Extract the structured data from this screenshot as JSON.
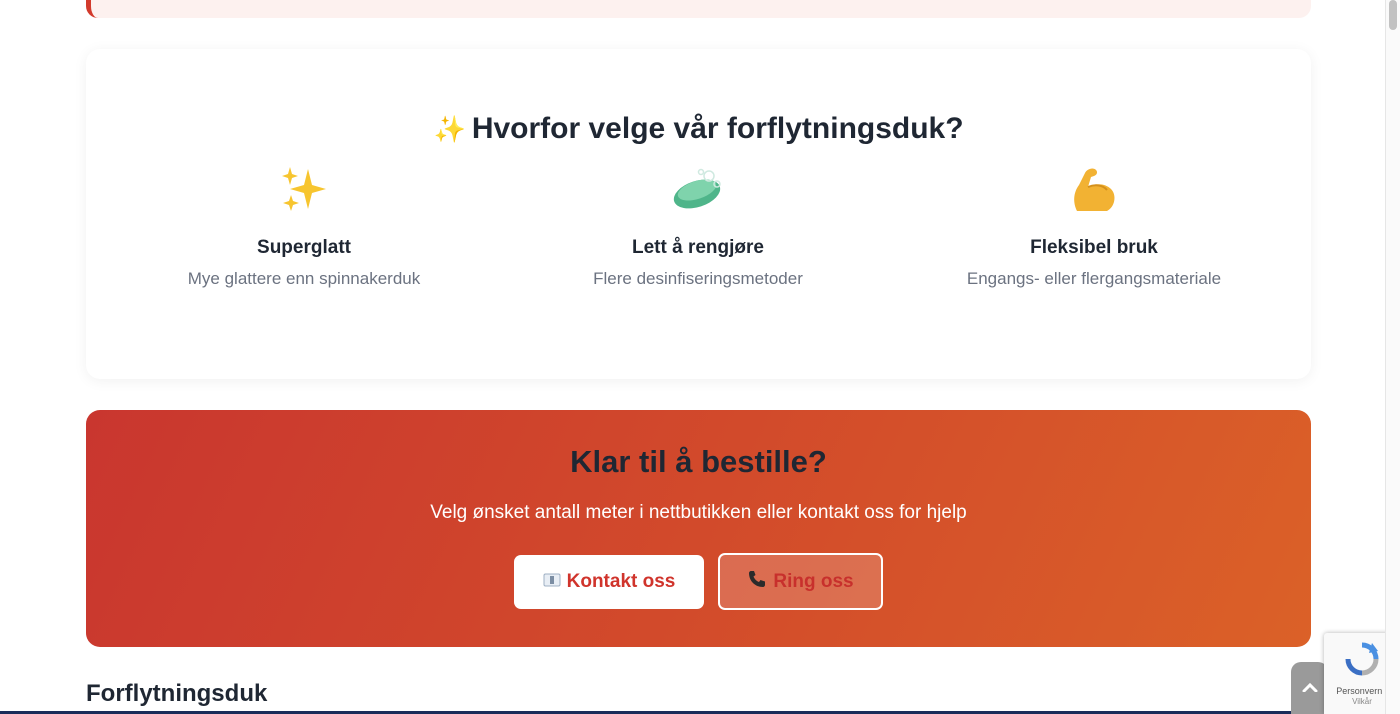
{
  "features_section": {
    "title_icon": "✨",
    "title": "Hvorfor velge vår forflytningsduk?",
    "items": [
      {
        "icon": "sparkles-icon",
        "title": "Superglatt",
        "description": "Mye glattere enn spinnakerduk"
      },
      {
        "icon": "soap-icon",
        "title": "Lett å rengjøre",
        "description": "Flere desinfiseringsmetoder"
      },
      {
        "icon": "flexed-biceps-icon",
        "title": "Fleksibel bruk",
        "description": "Engangs- eller flergangsmateriale"
      }
    ]
  },
  "cta": {
    "title": "Klar til å bestille?",
    "subtitle": "Velg ønsket antall meter i nettbutikken eller kontakt oss for hjelp",
    "contact_button": "Kontakt oss",
    "call_button": "Ring oss",
    "background_colors": [
      "#c9362f",
      "#db6128"
    ]
  },
  "bottom_heading": "Forflytningsduk",
  "recaptcha": {
    "label": "Personvern -",
    "label2": "Vilkår"
  },
  "colors": {
    "accent": "#d0342c",
    "text_dark": "#1f2733",
    "text_muted": "#6b7280"
  }
}
